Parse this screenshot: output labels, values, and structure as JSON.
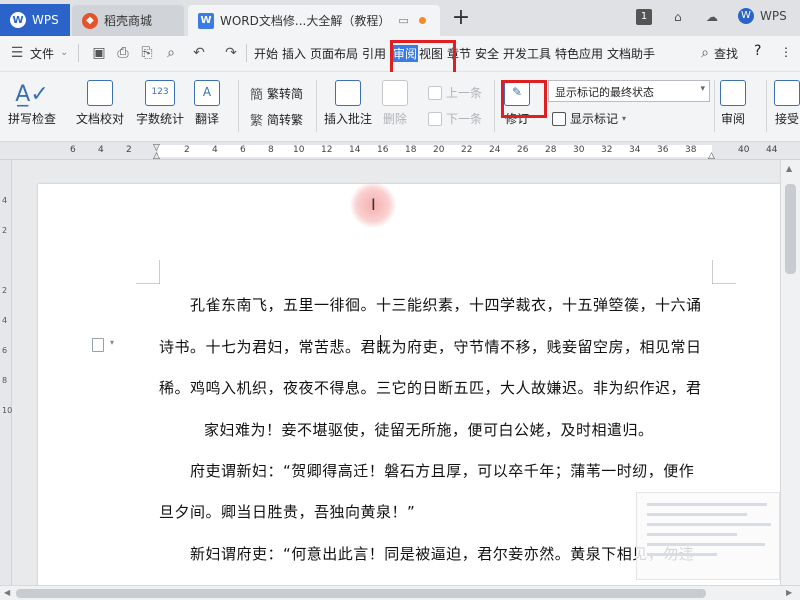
{
  "tabbar": {
    "wps_label": "WPS",
    "daoke_label": "稻壳商城",
    "doc_tab_label": "WORD文档修...大全解（教程）",
    "new_tab": "+",
    "window_badge": "1",
    "user_label": "WPS"
  },
  "menubar": {
    "file_label": "文件",
    "items": [
      "开始",
      "插入",
      "页面布局",
      "引用",
      "审阅",
      "视图",
      "章节",
      "安全",
      "开发工具",
      "特色应用",
      "文档助手"
    ],
    "search_label": "查找",
    "help": "?"
  },
  "ribbon": {
    "spell_check": "拼写检查",
    "doc_proof": "文档校对",
    "word_count": "字数统计",
    "translate": "翻译",
    "trad_convert": "繁转简",
    "simp_convert": "简转繁",
    "insert_comment": "插入批注",
    "delete": "删除",
    "prev": "上一条",
    "next": "下一条",
    "revise": "修订",
    "markup_state": "显示标记的最终状态",
    "show_markup": "显示标记",
    "review": "审阅",
    "accept": "接受"
  },
  "ruler": {
    "labels": [
      "6",
      "4",
      "2",
      "2",
      "4",
      "6",
      "8",
      "10",
      "12",
      "14",
      "16",
      "18",
      "20",
      "22",
      "24",
      "26",
      "28",
      "30",
      "32",
      "34",
      "36",
      "38",
      "40",
      "44"
    ],
    "vlabels": [
      "4",
      "2",
      "2",
      "4",
      "6",
      "8",
      "10"
    ]
  },
  "document": {
    "lines": [
      "孔雀东南飞，五里一徘徊。十三能织素，十四学裁衣，十五弹箜篌，十六诵",
      "诗书。十七为君妇，常苦悲。君既为府吏，守节情不移，贱妾留空房，相见常日",
      "稀。鸡鸣入机织，夜夜不得息。三它的日断五匹，大人故嫌迟。非为织作迟，君",
      "家妇难为！妾不堪驱使，徒留无所施，便可白公姥，及时相遣归。",
      "府吏谓新妇：“贺卿得高迁！磐石方且厚，可以卒千年；蒲苇一时纫，便作",
      "旦夕间。卿当日胜贵，吾独向黄泉！”",
      "新妇谓府吏：“何意出此言！同是被逼迫，君尔妾亦然。黄泉下相见，勿违"
    ]
  },
  "colors": {
    "wps_blue": "#2b63c8",
    "highlight_red": "#e02020",
    "daoke_red": "#e5532d",
    "doc_blue": "#3b7be6"
  }
}
